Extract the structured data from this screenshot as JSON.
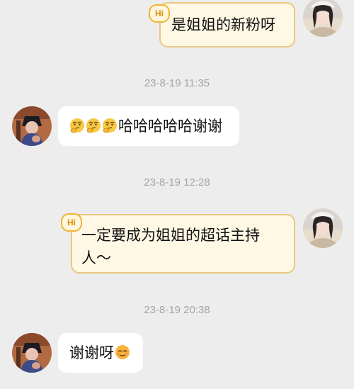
{
  "messages": [
    {
      "direction": "outgoing",
      "badge": "Hi",
      "text": "是姐姐的新粉呀"
    },
    {
      "timestamp": "23-8-19 11:35"
    },
    {
      "direction": "incoming",
      "emoji": [
        "thinking-face-icon",
        "thinking-face-icon",
        "thinking-face-icon"
      ],
      "text": "哈哈哈哈哈谢谢"
    },
    {
      "timestamp": "23-8-19 12:28"
    },
    {
      "direction": "outgoing",
      "badge": "Hi",
      "text_line1": "一定要成为姐姐的超话主持",
      "text_line2": "人～"
    },
    {
      "timestamp": "23-8-19 20:38"
    },
    {
      "direction": "incoming",
      "text": "谢谢呀",
      "emoji_after": "sweat-smile-icon"
    }
  ],
  "colors": {
    "background": "#ededed",
    "incoming_bubble": "#ffffff",
    "outgoing_bubble": "#fff8e5",
    "outgoing_border": "#e9c77f",
    "timestamp_text": "#a5a5a5",
    "hi_badge": "#f0b335"
  }
}
